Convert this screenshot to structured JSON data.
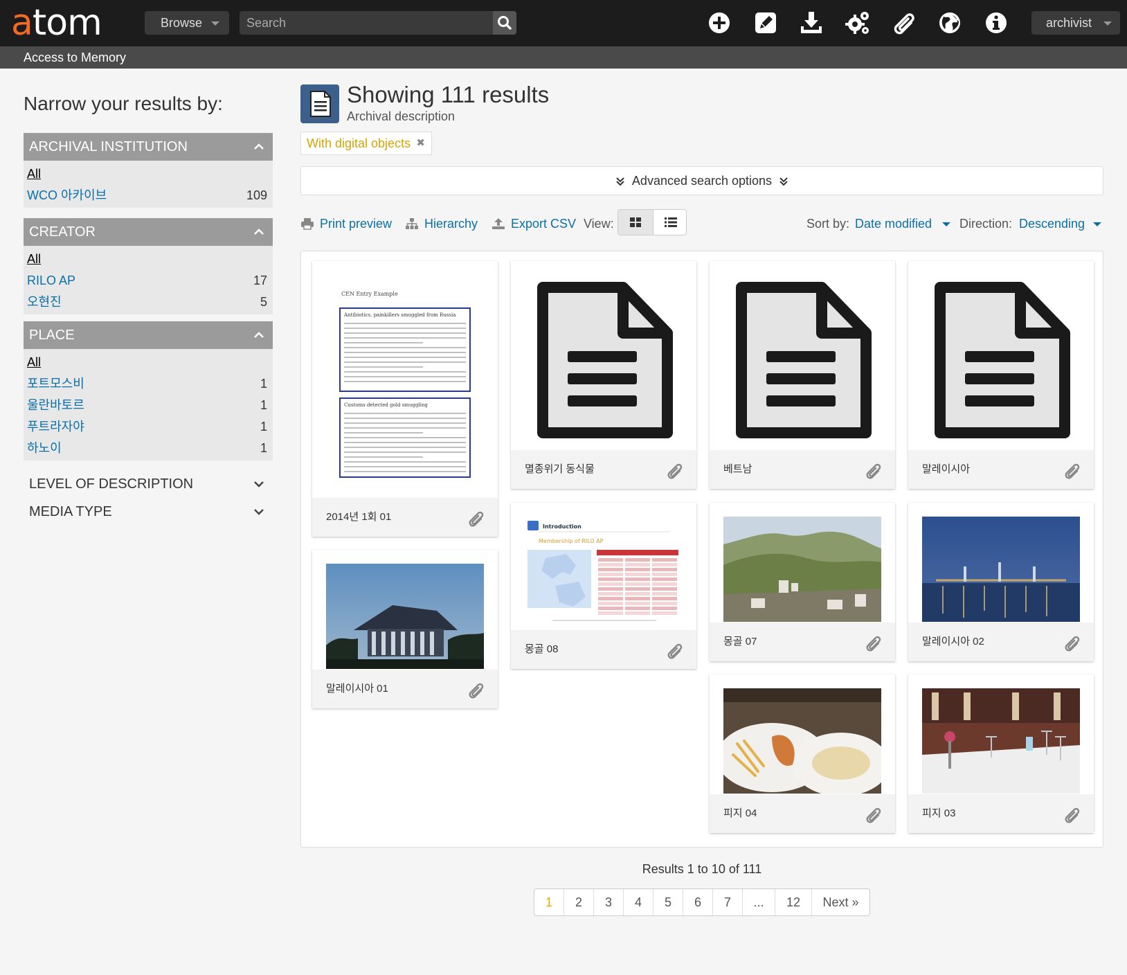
{
  "app": {
    "logo_a": "a",
    "logo_rest": "tom",
    "site_title": "Access to Memory"
  },
  "topbar": {
    "browse_label": "Browse",
    "search_placeholder": "Search",
    "user_label": "archivist",
    "icons": [
      "plus-circle-icon",
      "pencil-icon",
      "download-icon",
      "gears-icon",
      "paperclip-icon",
      "globe-icon",
      "info-icon"
    ]
  },
  "sidebar": {
    "title": "Narrow your results by:",
    "facets": [
      {
        "label": "ARCHIVAL INSTITUTION",
        "open": true,
        "rows": [
          {
            "label": "All",
            "count": ""
          },
          {
            "label": "WCO 아카이브",
            "count": "109"
          }
        ]
      },
      {
        "label": "CREATOR",
        "open": true,
        "rows": [
          {
            "label": "All",
            "count": ""
          },
          {
            "label": "RILO AP",
            "count": "17"
          },
          {
            "label": "오현진",
            "count": "5"
          }
        ]
      },
      {
        "label": "PLACE",
        "open": true,
        "rows": [
          {
            "label": "All",
            "count": ""
          },
          {
            "label": "포트모스비",
            "count": "1"
          },
          {
            "label": "울란바토르",
            "count": "1"
          },
          {
            "label": "푸트라자야",
            "count": "1"
          },
          {
            "label": "하노이",
            "count": "1"
          }
        ]
      },
      {
        "label": "LEVEL OF DESCRIPTION",
        "open": false,
        "rows": []
      },
      {
        "label": "MEDIA TYPE",
        "open": false,
        "rows": []
      }
    ]
  },
  "main": {
    "title": "Showing 111 results",
    "subtitle": "Archival description",
    "filter_tag": "With digital objects",
    "advanced_label": "Advanced search options",
    "print_label": "Print preview",
    "hierarchy_label": "Hierarchy",
    "export_label": "Export CSV",
    "view_label": "View:",
    "sort_by_label": "Sort by:",
    "sort_by_value": "Date modified",
    "direction_label": "Direction:",
    "direction_value": "Descending"
  },
  "results": [
    {
      "caption": "2014년 1회 01",
      "thumb": "document-scan"
    },
    {
      "caption": "멸종위기 동식물",
      "thumb": "generic-file-icon"
    },
    {
      "caption": "베트남",
      "thumb": "generic-file-icon"
    },
    {
      "caption": "말레이시아",
      "thumb": "generic-file-icon"
    },
    {
      "caption": "말레이시아 01",
      "thumb": "building-photo"
    },
    {
      "caption": "몽골 08",
      "thumb": "slide-map"
    },
    {
      "caption": "몽골 07",
      "thumb": "hills-photo"
    },
    {
      "caption": "말레이시아 02",
      "thumb": "bridge-night-photo"
    },
    {
      "caption": "피지 04",
      "thumb": "food-photo"
    },
    {
      "caption": "피지 03",
      "thumb": "dining-room-photo"
    }
  ],
  "scan_doc": {
    "heading": "CEN Entry Example",
    "box1_title": "Antibiotics, painkillers smuggled from Russia",
    "box2_title": "Customs detected gold smuggling"
  },
  "slide": {
    "tag": "Introduction",
    "subtitle": "Membership of RILO AP"
  },
  "pagination": {
    "summary": "Results 1 to 10 of 111",
    "pages": [
      "1",
      "2",
      "3",
      "4",
      "5",
      "6",
      "7",
      "...",
      "12",
      "Next »"
    ]
  },
  "colors": {
    "topbar": "#1c1c1c",
    "accent_orange": "#f26b25",
    "link_blue": "#0a6fa8",
    "facet_header": "#9b9b9b",
    "active_page": "#e8a800"
  }
}
